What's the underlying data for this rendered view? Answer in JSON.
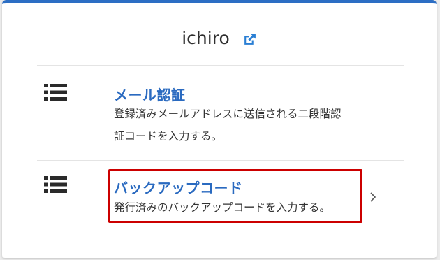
{
  "account": {
    "username": "ichiro",
    "edit_icon": "external-edit-icon"
  },
  "options": [
    {
      "icon": "list-icon",
      "title": "メール認証",
      "description_line1": "登録済みメールアドレスに送信される二段階認",
      "description_line2": "証コードを入力する。",
      "chevron": "chevron-right-icon"
    },
    {
      "icon": "list-icon",
      "title": "バックアップコード",
      "description": "発行済みのバックアップコードを入力する。",
      "chevron": "chevron-right-icon",
      "highlighted": true
    }
  ],
  "colors": {
    "accent": "#2c6ec4",
    "title": "#2a6ac0",
    "highlight": "#cc0000",
    "text": "#333333"
  }
}
